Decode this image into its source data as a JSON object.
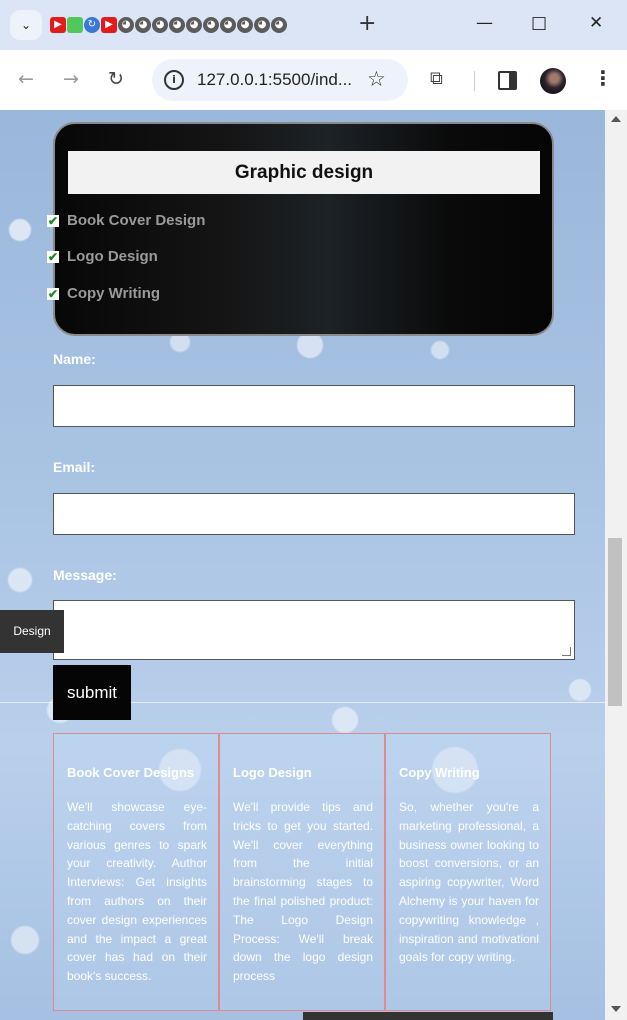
{
  "browser": {
    "url": "127.0.0.1:5500/ind...",
    "tab_icons": [
      "youtube-icon",
      "android-icon",
      "history-icon",
      "youtube-icon",
      "globe-icon",
      "globe-icon",
      "globe-icon",
      "globe-icon",
      "globe-icon",
      "globe-icon",
      "globe-icon",
      "globe-icon",
      "globe-icon",
      "globe-icon"
    ]
  },
  "graphic_card": {
    "title": "Graphic design",
    "items": [
      "Book Cover Design",
      "Logo Design",
      "Copy Writing"
    ]
  },
  "form": {
    "name_label": "Name:",
    "email_label": "Email:",
    "message_label": "Message:",
    "submit_label": "submit"
  },
  "side_tab": "Design",
  "cards": [
    {
      "title": "Book Cover Designs",
      "text": "We'll showcase eye-catching covers from various genres to spark your creativity. Author Interviews: Get insights from authors on their cover design experiences and the impact a great cover has had on their book's success."
    },
    {
      "title": "Logo Design",
      "text": "We'll provide tips and tricks to get you started. We'll cover everything from the initial brainstorming stages to the final polished product: The Logo Design Process: We'll break down the logo design process"
    },
    {
      "title": "Copy Writing",
      "text": "So, whether you're a marketing professional, a business owner looking to boost conversions, or an aspiring copywriter, Word Alchemy is your haven for copywriting knowledge , inspiration and motivationl goals for copy writing."
    }
  ]
}
